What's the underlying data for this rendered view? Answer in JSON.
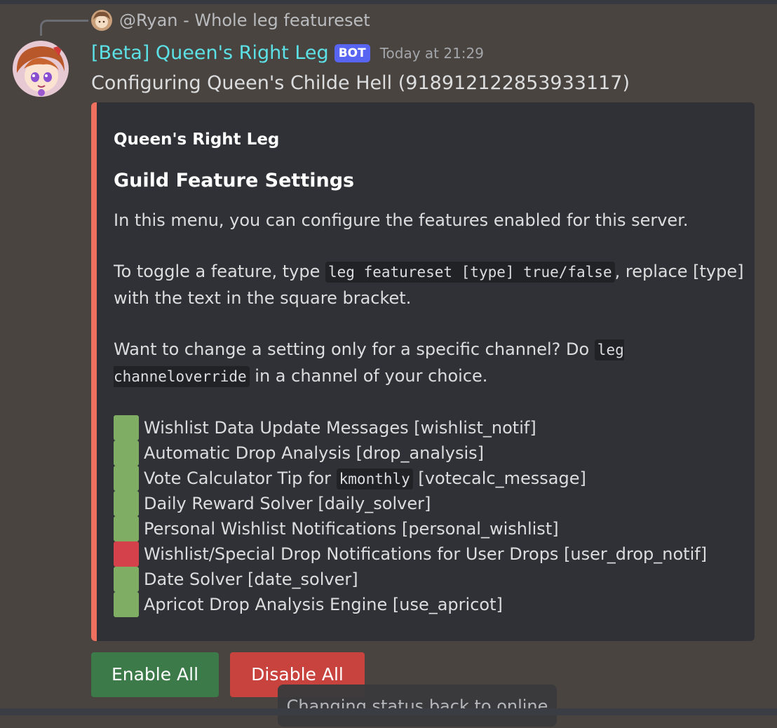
{
  "reply": {
    "text": "@Ryan - Whole leg featureset"
  },
  "message": {
    "username": "[Beta] Queen's Right Leg",
    "bot_tag": "BOT",
    "timestamp": "Today at 21:29",
    "content": "Configuring Queen's Childe Hell (918912122853933117)"
  },
  "embed": {
    "accent_color": "#f07060",
    "author": "Queen's Right Leg",
    "title": "Guild Feature Settings",
    "para1": "In this menu, you can configure the features enabled for this server.",
    "para2_before": "To toggle a feature, type ",
    "para2_code": "leg featureset [type] true/false",
    "para2_after": ", replace [type] with the text in the square bracket.",
    "para3_before": "Want to change a setting only for a specific channel? Do ",
    "para3_code": "leg channeloverride",
    "para3_after": " in a channel of your choice.",
    "features": [
      {
        "label": "Wishlist Data Update Messages [wishlist_notif]",
        "enabled": true
      },
      {
        "label": "Automatic Drop Analysis [drop_analysis]",
        "enabled": true
      },
      {
        "label_before": "Vote Calculator Tip for ",
        "code": "kmonthly",
        "label_after": " [votecalc_message]",
        "enabled": true
      },
      {
        "label": "Daily Reward Solver [daily_solver]",
        "enabled": true
      },
      {
        "label": "Personal Wishlist Notifications [personal_wishlist]",
        "enabled": true
      },
      {
        "label": "Wishlist/Special Drop Notifications for User Drops [user_drop_notif]",
        "enabled": false
      },
      {
        "label": "Date Solver [date_solver]",
        "enabled": true
      },
      {
        "label": "Apricot Drop Analysis Engine [use_apricot]",
        "enabled": true
      }
    ]
  },
  "buttons": {
    "enable_all": "Enable All",
    "disable_all": "Disable All"
  },
  "toast": {
    "text": "Changing status back to online"
  },
  "colors": {
    "enabled": "#7ead63",
    "disabled": "#d5414b",
    "username": "#5ce1e6",
    "bot_tag": "#5865f2"
  }
}
